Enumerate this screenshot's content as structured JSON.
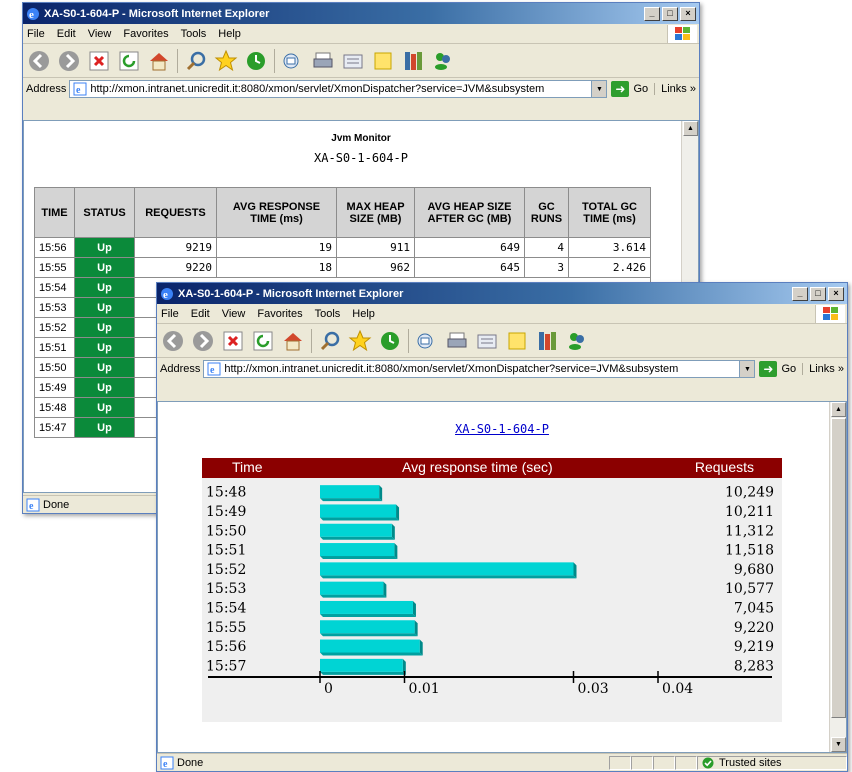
{
  "back_window": {
    "title": "XA-S0-1-604-P - Microsoft Internet Explorer",
    "menu": [
      "File",
      "Edit",
      "View",
      "Favorites",
      "Tools",
      "Help"
    ],
    "address_label": "Address",
    "address": "http://xmon.intranet.unicredit.it:8080/xmon/servlet/XmonDispatcher?service=JVM&subsystem",
    "go_label": "Go",
    "links_label": "Links",
    "status": "Done",
    "page": {
      "heading": "Jvm Monitor",
      "subheading": "XA-S0-1-604-P",
      "columns": [
        "TIME",
        "STATUS",
        "REQUESTS",
        "AVG RESPONSE TIME (ms)",
        "MAX HEAP SIZE (MB)",
        "AVG HEAP SIZE AFTER GC (MB)",
        "GC RUNS",
        "TOTAL GC TIME (ms)"
      ],
      "rows": [
        {
          "time": "15:56",
          "status": "Up",
          "requests": "9219",
          "avg_resp": "19",
          "max_heap": "911",
          "avg_heap": "649",
          "gc_runs": "4",
          "gc_time": "3.614"
        },
        {
          "time": "15:55",
          "status": "Up",
          "requests": "9220",
          "avg_resp": "18",
          "max_heap": "962",
          "avg_heap": "645",
          "gc_runs": "3",
          "gc_time": "2.426"
        },
        {
          "time": "15:54",
          "status": "Up"
        },
        {
          "time": "15:53",
          "status": "Up"
        },
        {
          "time": "15:52",
          "status": "Up"
        },
        {
          "time": "15:51",
          "status": "Up"
        },
        {
          "time": "15:50",
          "status": "Up"
        },
        {
          "time": "15:49",
          "status": "Up"
        },
        {
          "time": "15:48",
          "status": "Up"
        },
        {
          "time": "15:47",
          "status": "Up"
        }
      ]
    }
  },
  "front_window": {
    "title": "XA-S0-1-604-P - Microsoft Internet Explorer",
    "menu": [
      "File",
      "Edit",
      "View",
      "Favorites",
      "Tools",
      "Help"
    ],
    "address_label": "Address",
    "address": "http://xmon.intranet.unicredit.it:8080/xmon/servlet/XmonDispatcher?service=JVM&subsystem",
    "go_label": "Go",
    "links_label": "Links",
    "status": "Done",
    "zone": "Trusted sites",
    "page": {
      "link": "XA-S0-1-604-P"
    }
  },
  "toolbar_icons": [
    "back-icon",
    "forward-icon",
    "stop-icon",
    "refresh-icon",
    "home-icon",
    "search-icon",
    "favorites-icon",
    "history-icon",
    "mail-icon",
    "print-icon",
    "edit-icon",
    "discuss-icon",
    "research-icon",
    "messenger-icon"
  ],
  "colors": {
    "status_up": "#0b8a3a",
    "chart_header": "#8b0000",
    "bar": "#00d4d4"
  },
  "chart_data": {
    "type": "bar",
    "orientation": "horizontal",
    "header": {
      "left": "Time",
      "center": "Avg response time (sec)",
      "right": "Requests"
    },
    "categories": [
      "15:48",
      "15:49",
      "15:50",
      "15:51",
      "15:52",
      "15:53",
      "15:54",
      "15:55",
      "15:56",
      "15:57"
    ],
    "values": [
      0.007,
      0.009,
      0.0085,
      0.0088,
      0.03,
      0.0075,
      0.011,
      0.0112,
      0.0118,
      0.0098
    ],
    "requests": [
      "10,249",
      "10,211",
      "11,312",
      "11,518",
      "9,680",
      "10,577",
      "7,045",
      "9,220",
      "9,219",
      "8,283"
    ],
    "x_ticks": [
      "0",
      "0.01",
      "0.03",
      "0.04"
    ],
    "x_tick_values": [
      0,
      0.01,
      0.03,
      0.04
    ],
    "xlim": [
      0,
      0.04
    ]
  }
}
